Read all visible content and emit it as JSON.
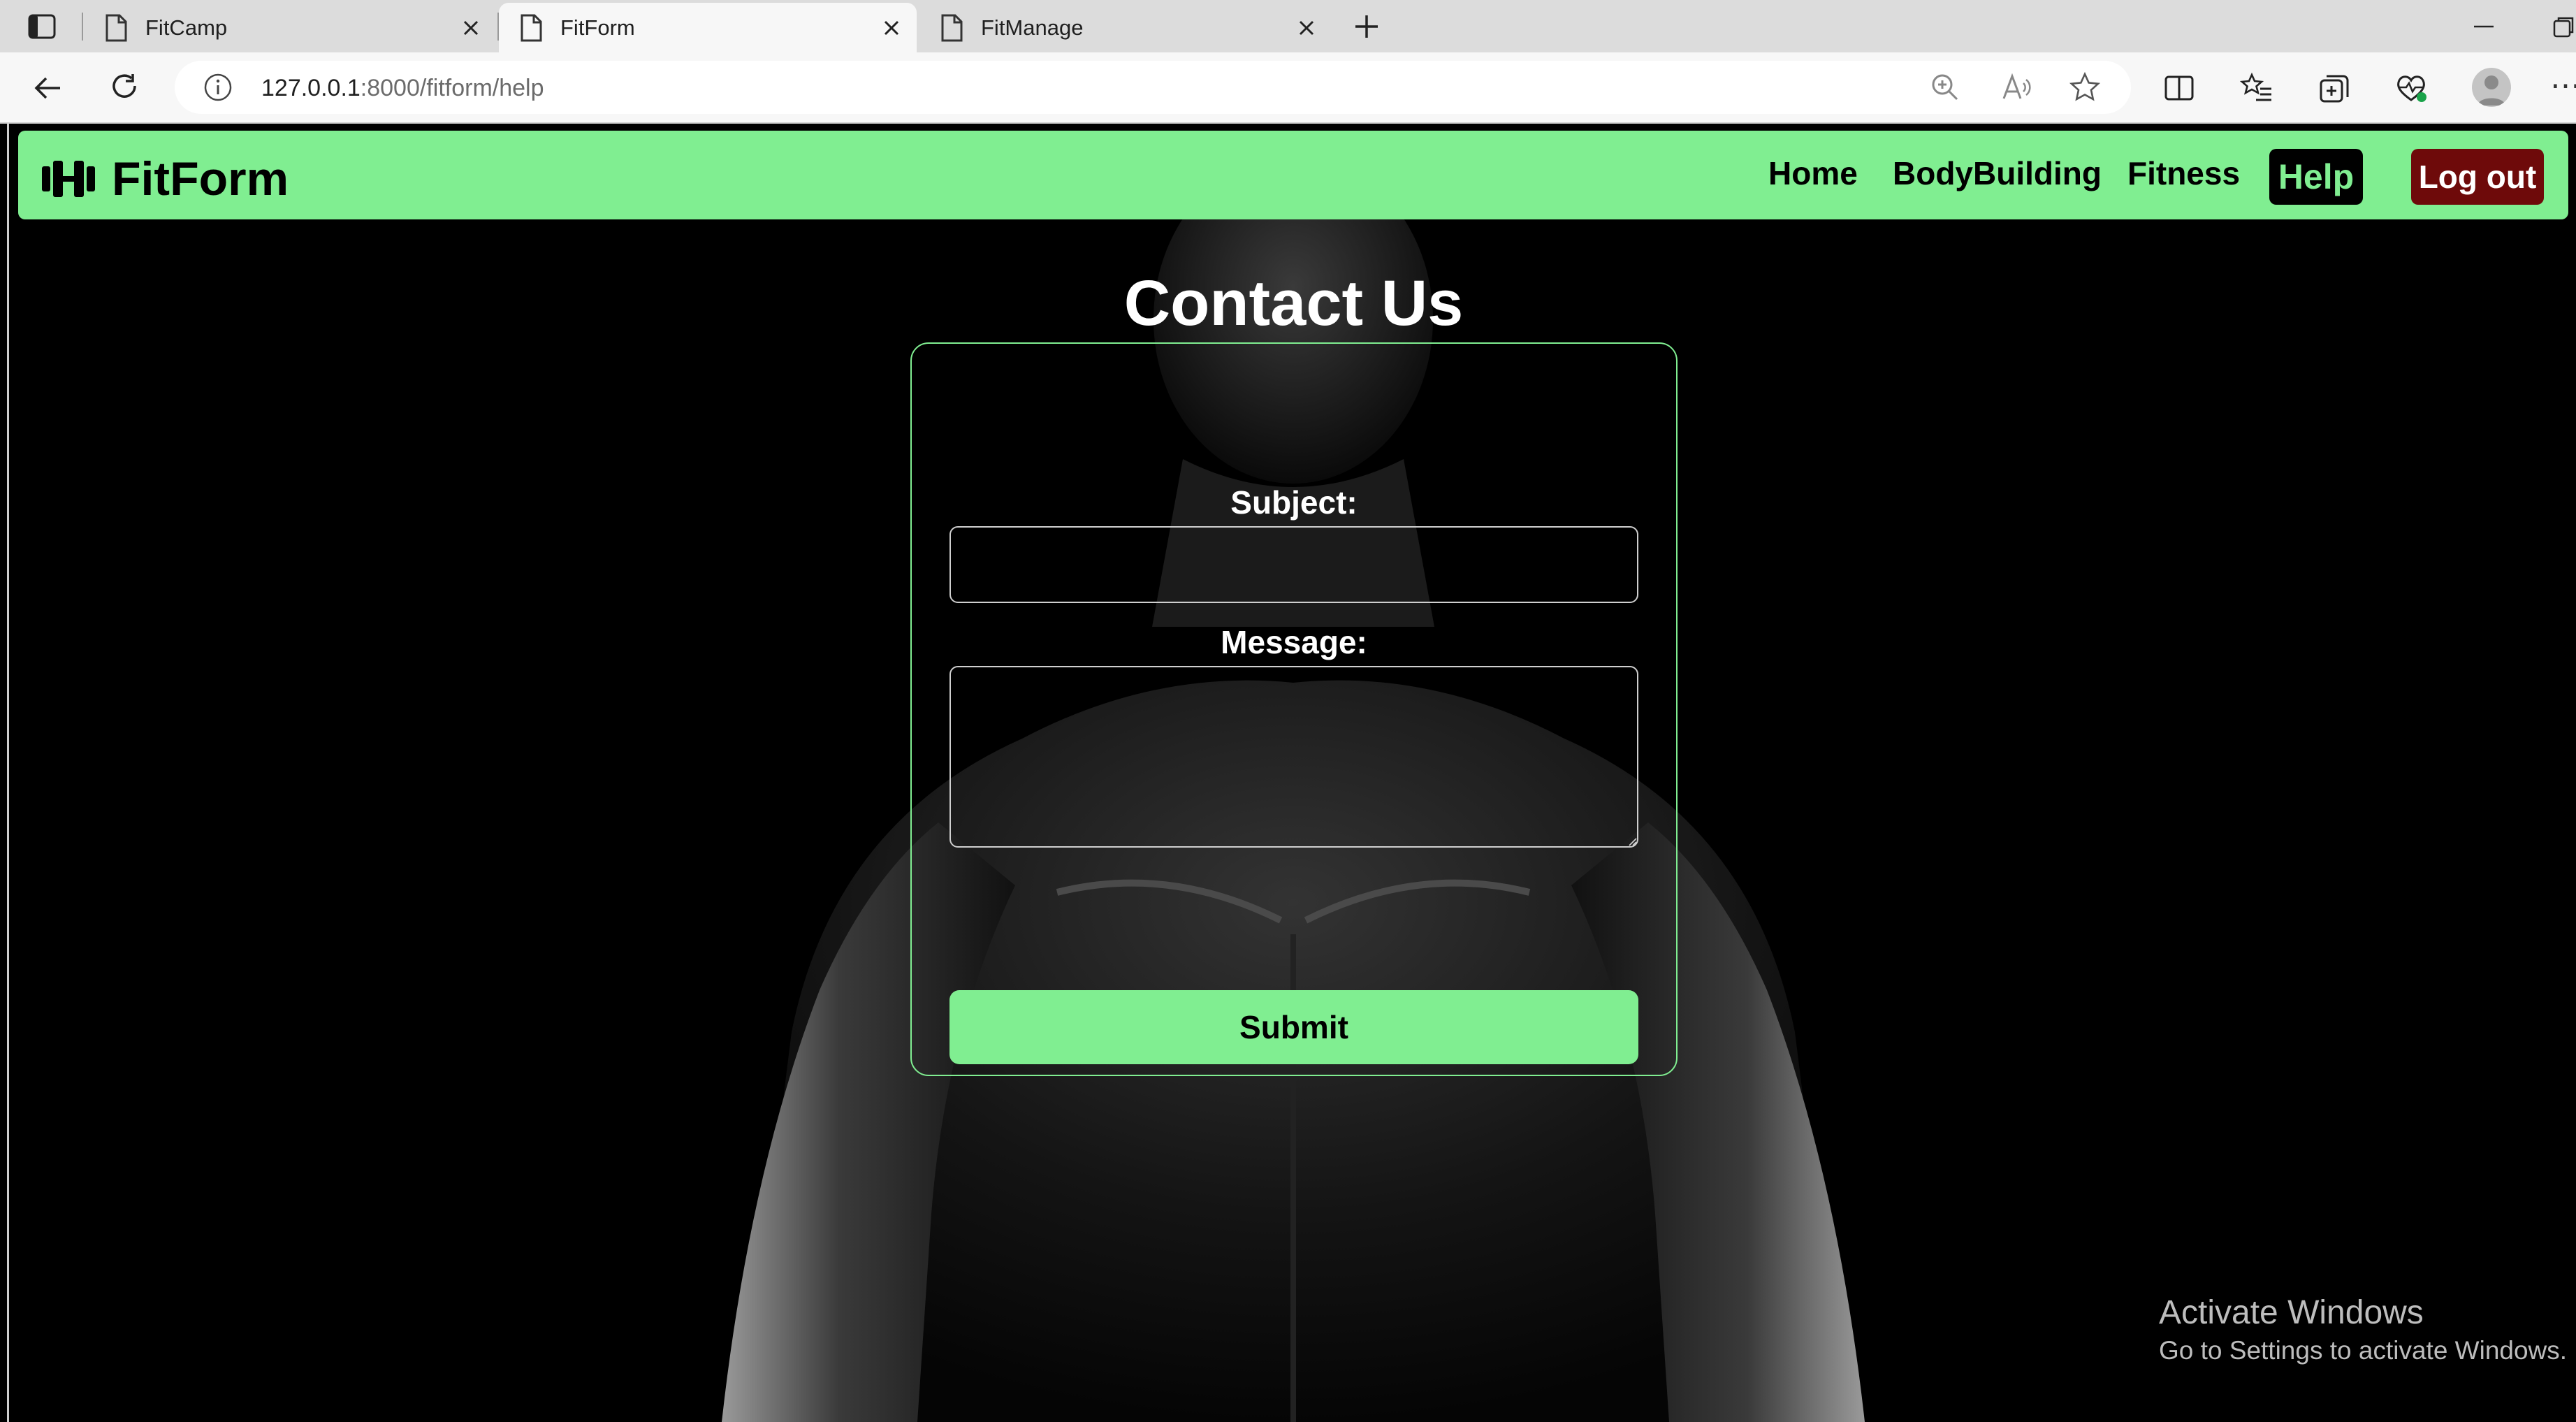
{
  "browser": {
    "tabs": [
      {
        "title": "FitCamp",
        "active": false
      },
      {
        "title": "FitForm",
        "active": true
      },
      {
        "title": "FitManage",
        "active": false
      }
    ],
    "url_host": "127.0.0.1",
    "url_path": ":8000/fitform/help"
  },
  "site": {
    "brand": "FitForm",
    "nav": {
      "home": "Home",
      "bodybuilding": "BodyBuilding",
      "fitness": "Fitness",
      "help": "Help",
      "logout": "Log out"
    },
    "accent_color": "#80ee91",
    "logout_color": "#6e0a0a"
  },
  "contact": {
    "title": "Contact Us",
    "subject_label": "Subject:",
    "subject_value": "",
    "message_label": "Message:",
    "message_value": "",
    "submit_label": "Submit"
  },
  "watermark": {
    "title": "Activate Windows",
    "subtitle": "Go to Settings to activate Windows."
  }
}
